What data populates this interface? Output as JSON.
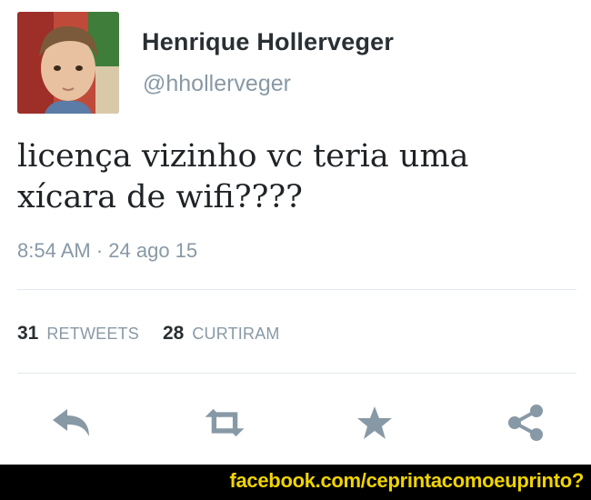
{
  "tweet": {
    "author_name": "Henrique Hollerveger",
    "handle": "@hhollerveger",
    "text_lines": [
      "licença vizinho vc teria uma",
      "xícara de wifi????"
    ],
    "timestamp": "8:54 AM · 24 ago 15"
  },
  "stats": {
    "retweets_count": "31",
    "retweets_label": "RETWEETS",
    "likes_count": "28",
    "likes_label": "CURTIRAM"
  },
  "actions": [
    "reply-icon",
    "retweet-icon",
    "favorite-star-icon",
    "share-icon"
  ],
  "footer": {
    "text": "facebook.com/ceprintacomoeuprinto?"
  },
  "colors": {
    "icon": "#8899a6",
    "muted_text": "#8899a6",
    "footer_bg": "#000000",
    "footer_text": "#f0d400"
  }
}
